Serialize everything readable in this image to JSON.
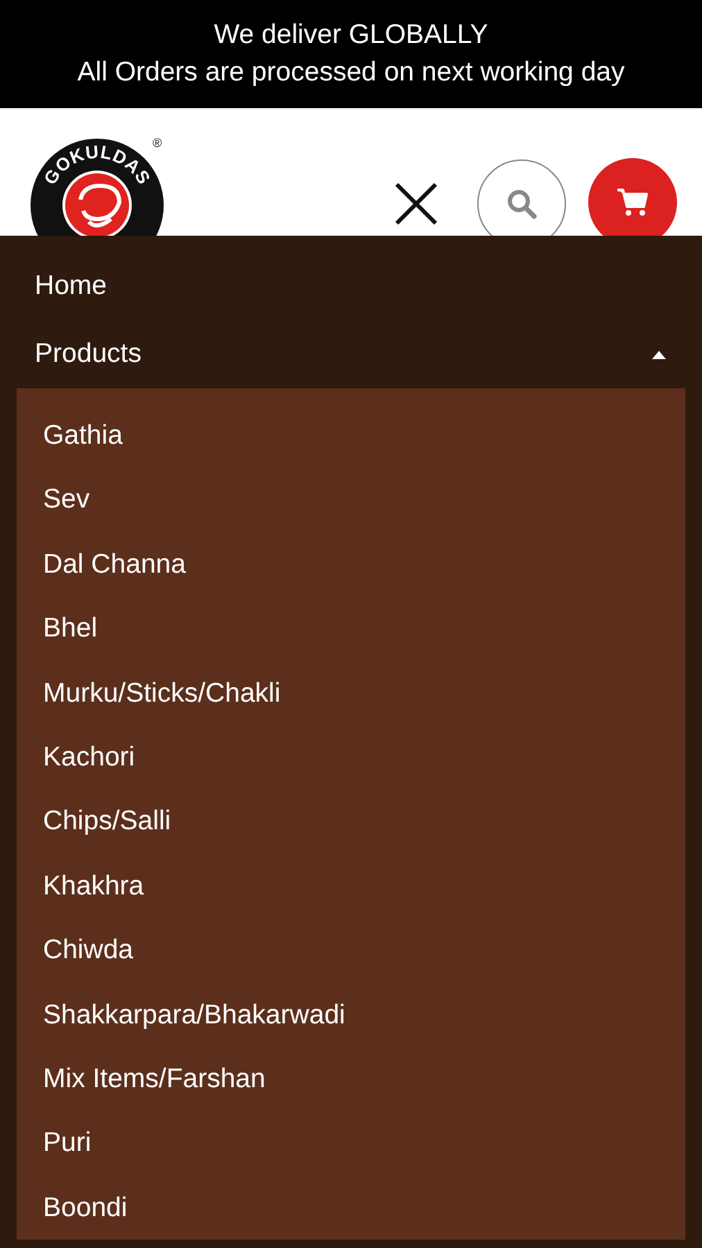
{
  "banner": {
    "lines": [
      "We deliver GLOBALLY",
      "All Orders are processed on next working day"
    ]
  },
  "header": {
    "logo_text": "GOKULDAS",
    "logo_mark": "®"
  },
  "nav": {
    "items": [
      {
        "label": "Home",
        "kind": "link"
      },
      {
        "label": "Products",
        "kind": "parent",
        "expanded": true,
        "children": [
          {
            "label": "Gathia"
          },
          {
            "label": "Sev"
          },
          {
            "label": "Dal Channa"
          },
          {
            "label": "Bhel"
          },
          {
            "label": "Murku/Sticks/Chakli"
          },
          {
            "label": "Kachori"
          },
          {
            "label": "Chips/Salli"
          },
          {
            "label": "Khakhra"
          },
          {
            "label": "Chiwda"
          },
          {
            "label": "Shakkarpara/Bhakarwadi"
          },
          {
            "label": "Mix Items/Farshan"
          },
          {
            "label": "Puri"
          },
          {
            "label": "Boondi"
          }
        ]
      }
    ]
  }
}
